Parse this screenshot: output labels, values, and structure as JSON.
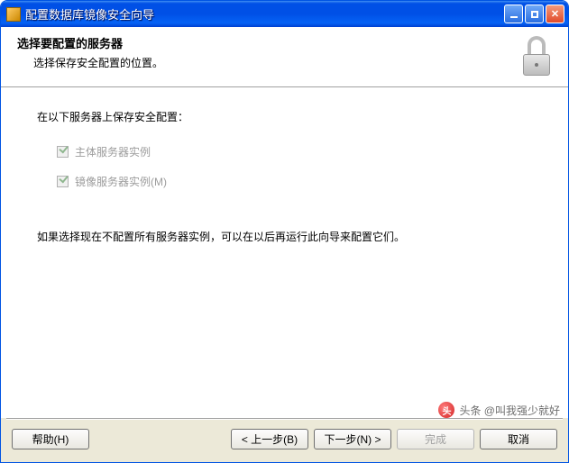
{
  "window": {
    "title": "配置数据库镜像安全向导"
  },
  "header": {
    "title": "选择要配置的服务器",
    "subtitle": "选择保存安全配置的位置。"
  },
  "body": {
    "instruction": "在以下服务器上保存安全配置：",
    "check_principal": "主体服务器实例",
    "check_mirror": "镜像服务器实例(M)",
    "note": "如果选择现在不配置所有服务器实例，可以在以后再运行此向导来配置它们。"
  },
  "footer": {
    "help": "帮助(H)",
    "back": "< 上一步(B)",
    "next": "下一步(N) >",
    "finish": "完成",
    "cancel": "取消"
  },
  "watermark": {
    "text": "头条 @叫我强少就好"
  }
}
